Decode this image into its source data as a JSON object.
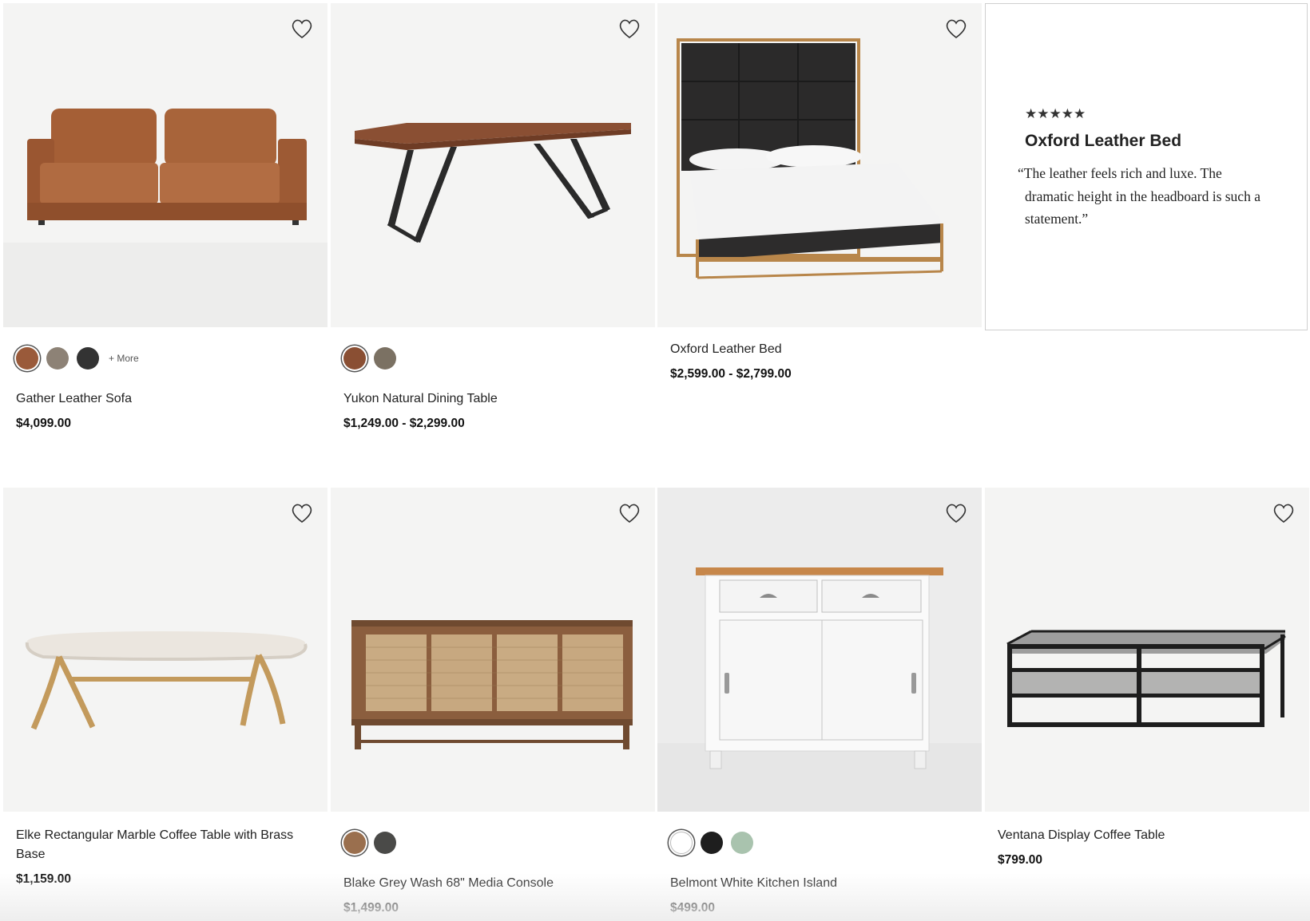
{
  "products": [
    {
      "name": "Gather Leather Sofa",
      "price": "$4,099.00",
      "swatches": [
        "#9a5a3a",
        "#8d8276",
        "#333333"
      ],
      "more_label": "+ More",
      "icon": "sofa"
    },
    {
      "name": "Yukon Natural Dining Table",
      "price": "$1,249.00 - $2,299.00",
      "swatches": [
        "#8a4f33",
        "#7b7163"
      ],
      "icon": "dining-table"
    },
    {
      "name": "Oxford Leather Bed",
      "price": "$2,599.00 - $2,799.00",
      "icon": "bed"
    },
    {
      "name": "Elke Rectangular Marble Coffee Table with Brass Base",
      "price": "$1,159.00",
      "icon": "coffee-table"
    },
    {
      "name": "Blake Grey Wash 68\" Media Console",
      "price": "$1,499.00",
      "swatches": [
        "#9a6f4e",
        "#4a4a48"
      ],
      "icon": "media-console"
    },
    {
      "name": "Belmont White Kitchen Island",
      "price": "$499.00",
      "swatches": [
        "#ffffff",
        "#1e1e1e",
        "#a9c3ae"
      ],
      "icon": "kitchen-island"
    },
    {
      "name": "Ventana Display Coffee Table",
      "price": "$799.00",
      "icon": "display-table"
    }
  ],
  "review": {
    "stars": "★★★★★",
    "title": "Oxford Leather Bed",
    "quote": "“The leather feels rich and luxe. The dramatic height in the headboard is such a statement.”"
  }
}
